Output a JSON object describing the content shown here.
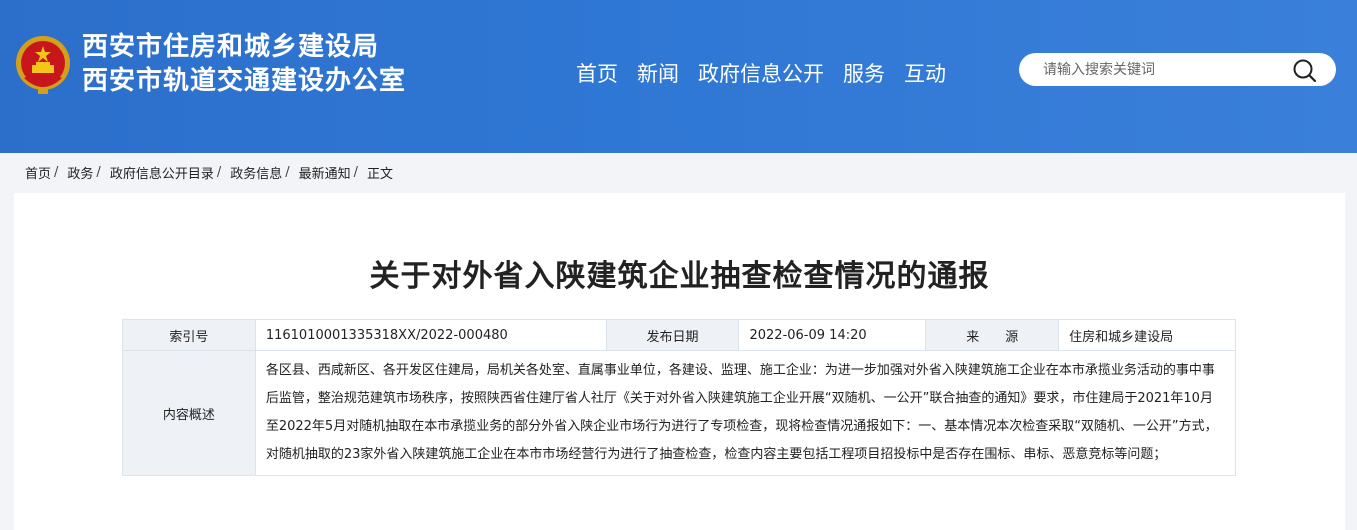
{
  "header": {
    "title_line1": "西安市住房和城乡建设局",
    "title_line2": "西安市轨道交通建设办公室",
    "emblem_icon": "national-emblem-icon",
    "bg_color": "#2f77d4"
  },
  "nav": {
    "items": [
      "首页",
      "新闻",
      "政府信息公开",
      "服务",
      "互动"
    ]
  },
  "search": {
    "placeholder": "请输入搜索关键词",
    "icon": "search-icon"
  },
  "breadcrumb": {
    "items": [
      "首页",
      "政务",
      "政府信息公开目录",
      "政务信息",
      "最新通知",
      "正文"
    ],
    "separator": "/"
  },
  "article": {
    "title": "关于对外省入陕建筑企业抽查检查情况的通报",
    "meta": {
      "index_label": "索引号",
      "index_value": "1161010001335318XX/2022-000480",
      "date_label": "发布日期",
      "date_value": "2022-06-09 14:20",
      "source_label": "来　　源",
      "source_value": "住房和城乡建设局",
      "summary_label": "内容概述",
      "summary_value": "各区县、西咸新区、各开发区住建局，局机关各处室、直属事业单位，各建设、监理、施工企业：为进一步加强对外省入陕建筑施工企业在本市承揽业务活动的事中事后监管，整治规范建筑市场秩序，按照陕西省住建厅省人社厅《关于对外省入陕建筑施工企业开展“双随机、一公开”联合抽查的通知》要求，市住建局于2021年10月至2022年5月对随机抽取在本市承揽业务的部分外省入陕企业市场行为进行了专项检查，现将检查情况通报如下：一、基本情况本次检查采取“双随机、一公开”方式，对随机抽取的23家外省入陕建筑施工企业在本市市场经营行为进行了抽查检查，检查内容主要包括工程项目招投标中是否存在围标、串标、恶意竞标等问题；"
    }
  }
}
